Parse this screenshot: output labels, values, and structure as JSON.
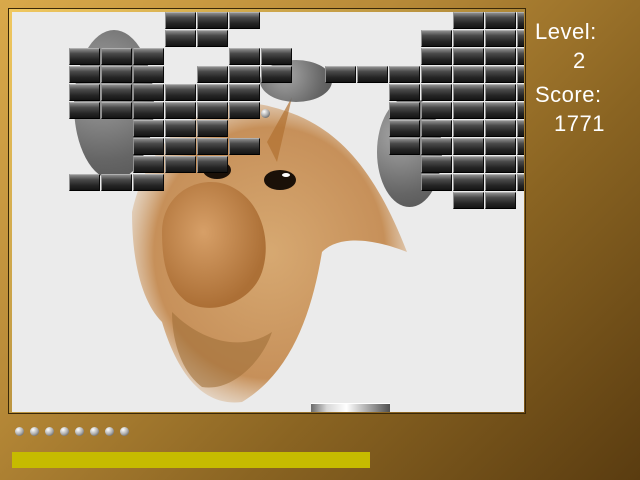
{
  "hud": {
    "level_label": "Level:",
    "level_value": "2",
    "score_label": "Score:",
    "score_value": "1771"
  },
  "lives_remaining": 8,
  "energy_fraction": 1.0,
  "colors": {
    "energy_bar": "#c6bb00",
    "frame_gold": "#d9a94a",
    "playfield": "#ebebeb",
    "brick": "#2a2a2a"
  },
  "background_art": "gnu-head-mascot",
  "ball": "silver-ball",
  "paddle": "silver-paddle"
}
